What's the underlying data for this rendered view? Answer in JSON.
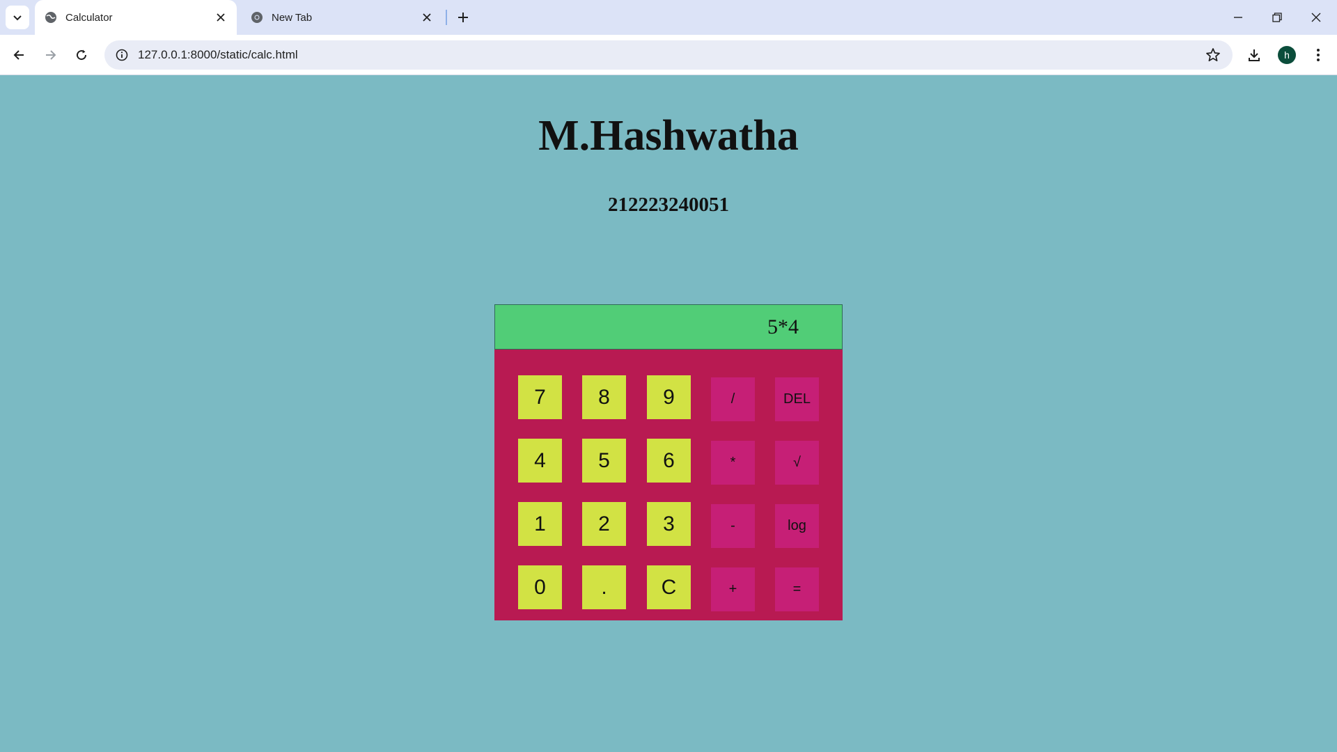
{
  "browser": {
    "tabs": [
      {
        "title": "Calculator",
        "active": true
      },
      {
        "title": "New Tab",
        "active": false
      }
    ],
    "url": "127.0.0.1:8000/static/calc.html",
    "profile_initial": "h"
  },
  "page": {
    "title": "M.Hashwatha",
    "subtitle": "212223240051"
  },
  "calculator": {
    "display": "5*4",
    "colors": {
      "background": "#7bbac3",
      "body": "#b81a52",
      "display": "#51cd77",
      "number_key": "#d2e244",
      "operator_key": "#c61f76"
    },
    "keys": {
      "k7": "7",
      "k8": "8",
      "k9": "9",
      "div": "/",
      "del": "DEL",
      "k4": "4",
      "k5": "5",
      "k6": "6",
      "mul": "*",
      "sqrt": "√",
      "k1": "1",
      "k2": "2",
      "k3": "3",
      "sub": "-",
      "log": "log",
      "k0": "0",
      "dot": ".",
      "clear": "C",
      "add": "+",
      "eq": "="
    }
  }
}
